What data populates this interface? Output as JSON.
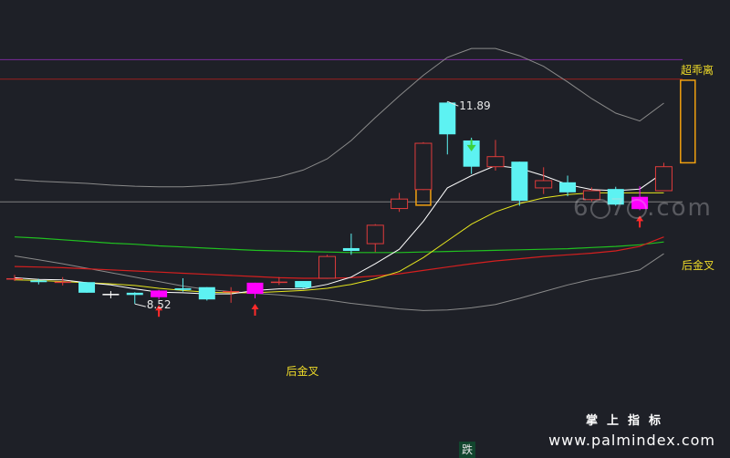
{
  "chart_data": {
    "type": "candlestick",
    "ylim": [
      7.0,
      13.2
    ],
    "price_high_label": "11.89",
    "price_low_label": "8.52",
    "resistance_lines": [
      {
        "value": 12.9,
        "color": "#7a2a9a"
      },
      {
        "value": 12.55,
        "color": "#9a1f1f"
      }
    ],
    "support_line": {
      "value": 10.35,
      "color": "#808080"
    },
    "candles": [
      {
        "o": 8.98,
        "c": 8.98,
        "h": 9.04,
        "l": 8.93
      },
      {
        "o": 8.94,
        "c": 8.91,
        "h": 8.97,
        "l": 8.87
      },
      {
        "o": 8.92,
        "c": 8.92,
        "h": 9.0,
        "l": 8.85
      },
      {
        "o": 8.91,
        "c": 8.72,
        "h": 8.91,
        "l": 8.72
      },
      {
        "o": 8.7,
        "c": 8.7,
        "h": 8.75,
        "l": 8.62
      },
      {
        "o": 8.72,
        "c": 8.68,
        "h": 8.73,
        "l": 8.52
      },
      {
        "o": 8.76,
        "c": 8.64,
        "h": 8.77,
        "l": 8.6
      },
      {
        "o": 8.8,
        "c": 8.77,
        "h": 8.98,
        "l": 8.74
      },
      {
        "o": 8.82,
        "c": 8.6,
        "h": 8.82,
        "l": 8.58
      },
      {
        "o": 8.75,
        "c": 8.74,
        "h": 8.82,
        "l": 8.54
      },
      {
        "o": 8.9,
        "c": 8.7,
        "h": 8.9,
        "l": 8.62
      },
      {
        "o": 8.92,
        "c": 8.92,
        "h": 9.0,
        "l": 8.86
      },
      {
        "o": 8.93,
        "c": 8.81,
        "h": 8.93,
        "l": 8.8
      },
      {
        "o": 8.98,
        "c": 9.37,
        "h": 9.4,
        "l": 8.97
      },
      {
        "o": 9.52,
        "c": 9.47,
        "h": 9.78,
        "l": 9.4
      },
      {
        "o": 9.6,
        "c": 9.93,
        "h": 9.95,
        "l": 9.45
      },
      {
        "o": 10.23,
        "c": 10.4,
        "h": 10.51,
        "l": 10.17
      },
      {
        "o": 10.57,
        "c": 11.4,
        "h": 11.42,
        "l": 10.56
      },
      {
        "o": 12.13,
        "c": 11.56,
        "h": 12.15,
        "l": 11.2
      },
      {
        "o": 11.45,
        "c": 10.98,
        "h": 11.5,
        "l": 10.85
      },
      {
        "o": 10.98,
        "c": 11.16,
        "h": 11.46,
        "l": 10.91
      },
      {
        "o": 11.07,
        "c": 10.37,
        "h": 11.07,
        "l": 10.28
      },
      {
        "o": 10.6,
        "c": 10.73,
        "h": 10.97,
        "l": 10.49
      },
      {
        "o": 10.7,
        "c": 10.52,
        "h": 10.82,
        "l": 10.45
      },
      {
        "o": 10.39,
        "c": 10.55,
        "h": 10.61,
        "l": 10.36
      },
      {
        "o": 10.58,
        "c": 10.3,
        "h": 10.62,
        "l": 10.28
      },
      {
        "o": 10.22,
        "c": 10.44,
        "h": 10.63,
        "l": 10.2
      },
      {
        "o": 10.55,
        "c": 10.98,
        "h": 11.05,
        "l": 10.55
      }
    ],
    "ma_short": [
      8.99,
      8.96,
      8.95,
      8.9,
      8.86,
      8.79,
      8.73,
      8.72,
      8.7,
      8.7,
      8.76,
      8.79,
      8.79,
      8.87,
      9.0,
      9.24,
      9.5,
      10.0,
      10.6,
      10.82,
      11.0,
      10.95,
      10.82,
      10.66,
      10.57,
      10.55,
      10.58,
      10.88
    ],
    "ma_mid": [
      8.95,
      8.94,
      8.92,
      8.9,
      8.88,
      8.85,
      8.8,
      8.76,
      8.73,
      8.72,
      8.72,
      8.74,
      8.76,
      8.8,
      8.87,
      8.97,
      9.1,
      9.35,
      9.65,
      9.95,
      10.17,
      10.32,
      10.42,
      10.48,
      10.51,
      10.51,
      10.51,
      10.51
    ],
    "ma_long": [
      9.19,
      9.18,
      9.17,
      9.15,
      9.13,
      9.11,
      9.09,
      9.07,
      9.05,
      9.03,
      9.01,
      8.99,
      8.98,
      8.98,
      8.99,
      9.02,
      9.06,
      9.12,
      9.18,
      9.24,
      9.29,
      9.33,
      9.37,
      9.4,
      9.43,
      9.47,
      9.55,
      9.72
    ],
    "ma_trend": [
      9.72,
      9.7,
      9.67,
      9.64,
      9.61,
      9.59,
      9.56,
      9.54,
      9.52,
      9.5,
      9.48,
      9.47,
      9.46,
      9.45,
      9.44,
      9.44,
      9.44,
      9.45,
      9.46,
      9.47,
      9.48,
      9.49,
      9.5,
      9.51,
      9.53,
      9.55,
      9.58,
      9.63
    ],
    "band_upper": [
      10.75,
      10.72,
      10.7,
      10.68,
      10.65,
      10.63,
      10.62,
      10.62,
      10.64,
      10.67,
      10.73,
      10.8,
      10.92,
      11.12,
      11.45,
      11.86,
      12.25,
      12.62,
      12.94,
      13.1,
      13.1,
      12.97,
      12.78,
      12.5,
      12.2,
      11.94,
      11.8,
      12.12
    ],
    "band_lower": [
      9.38,
      9.31,
      9.24,
      9.16,
      9.08,
      9.0,
      8.92,
      8.84,
      8.78,
      8.74,
      8.71,
      8.68,
      8.64,
      8.59,
      8.53,
      8.48,
      8.43,
      8.4,
      8.41,
      8.45,
      8.51,
      8.62,
      8.74,
      8.86,
      8.96,
      9.04,
      9.13,
      9.42
    ],
    "buy_signals": [
      {
        "index": 6,
        "label": ""
      },
      {
        "index": 10,
        "label": "后金叉"
      },
      {
        "index": 26,
        "label": ""
      }
    ],
    "sell_signals": [
      {
        "index": 19
      }
    ],
    "signal_box_bars": [
      {
        "index": 17,
        "top": 11.0,
        "bottom": 10.29
      },
      {
        "index": 28,
        "top": 12.53,
        "bottom": 11.05
      }
    ],
    "tags": {
      "overbought": "超乖离",
      "golden_cross": "后金叉"
    }
  },
  "status_badge": "跌",
  "watermark": {
    "title": "掌上指标",
    "url": "www.palmindex.com",
    "logo_parts": [
      "6",
      "o",
      "7",
      "o",
      ".com"
    ]
  },
  "colors": {
    "background": "#1e2027",
    "up": "#e03b3b",
    "down": "#5df2f2",
    "buy_arrow": "#ff2a2a",
    "sell_arrow": "#3cd23c",
    "signal_bar": "#ff00ff",
    "ma_short": "#ffffff",
    "ma_mid": "#e6e61e",
    "ma_long": "#d41f1f",
    "ma_trend": "#20c020",
    "band": "#8a8a8a",
    "box_bar": "#f0a010",
    "tag": "#f0dc28"
  }
}
